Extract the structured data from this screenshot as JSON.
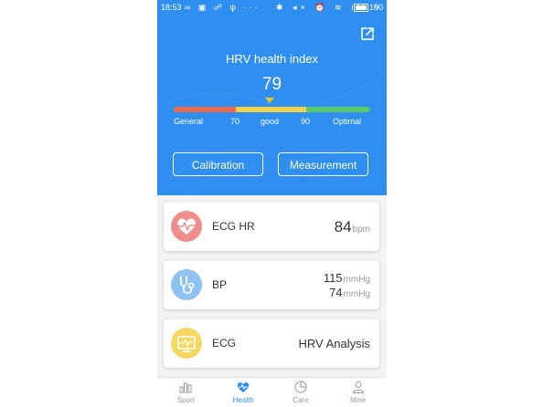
{
  "status_bar": {
    "time": "18:53",
    "left_icons": "∞ ▣ ☍ ψ ···",
    "right_icons": "✱ ◂× ⏰ ≋ ıll ϟ",
    "battery": "100"
  },
  "header": {
    "title": "HRV health index",
    "score": "79",
    "score_fraction": 0.49,
    "scale": {
      "labels": [
        "General",
        "70",
        "good",
        "90",
        "Optimal"
      ],
      "colors": [
        "#ef6b4f",
        "#f3d24a",
        "#5bc86a"
      ]
    },
    "calibration_label": "Calibration",
    "measurement_label": "Measurement",
    "share_icon": "share-icon"
  },
  "cards": {
    "ecg_hr": {
      "label": "ECG HR",
      "value": "84",
      "unit": "bpm",
      "icon": "heart-pulse-icon",
      "icon_color": "#f08e8e"
    },
    "bp": {
      "label": "BP",
      "systolic": "115",
      "diastolic": "74",
      "unit": "mmHg",
      "icon": "stethoscope-icon",
      "icon_color": "#8ec2f0"
    },
    "ecg": {
      "label": "ECG",
      "action": "HRV Analysis",
      "icon": "monitor-ecg-icon",
      "icon_color": "#f5d862"
    }
  },
  "tabbar": {
    "items": [
      {
        "label": "Sport",
        "icon": "bar-chart-icon"
      },
      {
        "label": "Health",
        "icon": "heart-pulse-icon",
        "active": true
      },
      {
        "label": "Care",
        "icon": "pie-chart-icon"
      },
      {
        "label": "Mine",
        "icon": "user-icon"
      }
    ],
    "active_color": "#2f8ff0"
  },
  "colors": {
    "primary": "#2f8ff0",
    "background": "#f2f3f5"
  }
}
